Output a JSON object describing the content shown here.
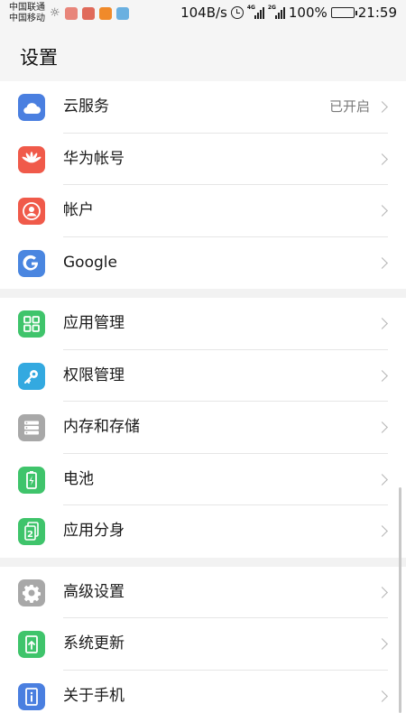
{
  "status": {
    "carrier1": "中国联通",
    "carrier2": "中国移动",
    "speed": "104B/s",
    "net1": "4G",
    "net2": "2G",
    "battery": "100%",
    "time": "21:59"
  },
  "header": {
    "title": "设置"
  },
  "groups": [
    [
      {
        "label": "云服务",
        "value": "已开启",
        "icon": "cloud-icon",
        "color": "#4a7fe0"
      },
      {
        "label": "华为帐号",
        "value": "",
        "icon": "huawei-icon",
        "color": "#f05a4a"
      },
      {
        "label": "帐户",
        "value": "",
        "icon": "account-icon",
        "color": "#f05a4a"
      },
      {
        "label": "Google",
        "value": "",
        "icon": "google-icon",
        "color": "#4a86e0"
      }
    ],
    [
      {
        "label": "应用管理",
        "value": "",
        "icon": "apps-icon",
        "color": "#3fc46b"
      },
      {
        "label": "权限管理",
        "value": "",
        "icon": "key-icon",
        "color": "#33a9e0"
      },
      {
        "label": "内存和存储",
        "value": "",
        "icon": "storage-icon",
        "color": "#a8a8a8"
      },
      {
        "label": "电池",
        "value": "",
        "icon": "battery-icon",
        "color": "#3fc46b"
      },
      {
        "label": "应用分身",
        "value": "",
        "icon": "app-twin-icon",
        "color": "#3fc46b"
      }
    ],
    [
      {
        "label": "高级设置",
        "value": "",
        "icon": "gear-icon",
        "color": "#a8a8a8"
      },
      {
        "label": "系统更新",
        "value": "",
        "icon": "update-icon",
        "color": "#3fc46b"
      },
      {
        "label": "关于手机",
        "value": "",
        "icon": "info-icon",
        "color": "#4a7fe0"
      }
    ]
  ]
}
